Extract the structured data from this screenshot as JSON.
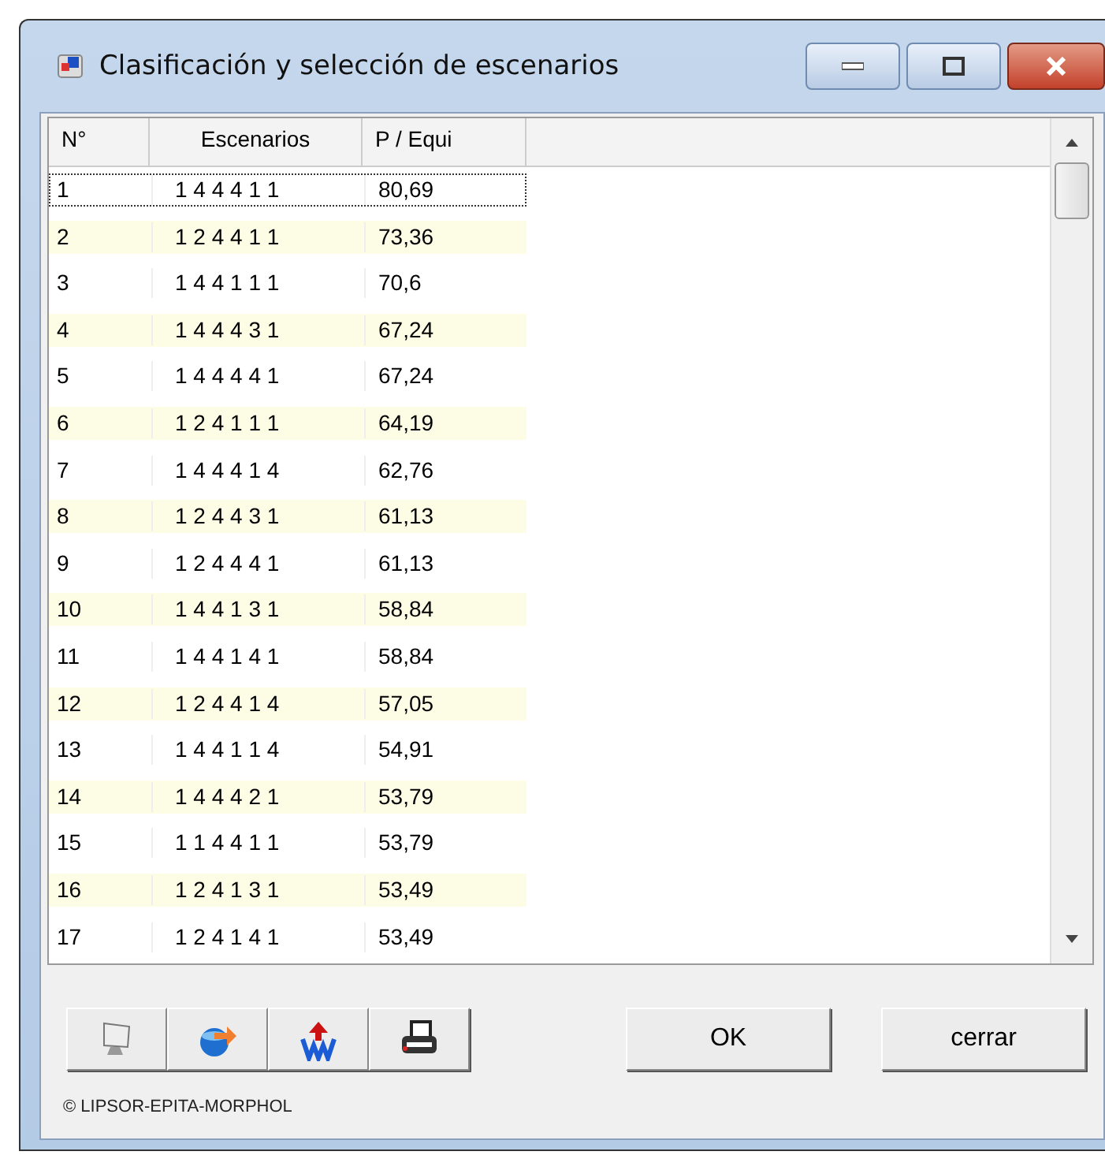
{
  "window": {
    "title": "Clasificación y selección de escenarios"
  },
  "table": {
    "columns": [
      "N°",
      "Escenarios",
      "P / Equi"
    ],
    "rows": [
      {
        "cells": [
          "1",
          "1 4 4 4 1 1",
          "80,69"
        ],
        "focused": true
      },
      {
        "cells": [
          "2",
          "1 2 4 4 1 1",
          "73,36"
        ],
        "focused": false
      },
      {
        "cells": [
          "3",
          "1 4 4 1 1 1",
          "70,6"
        ],
        "focused": false
      },
      {
        "cells": [
          "4",
          "1 4 4 4 3 1",
          "67,24"
        ],
        "focused": false
      },
      {
        "cells": [
          "5",
          "1 4 4 4 4 1",
          "67,24"
        ],
        "focused": false
      },
      {
        "cells": [
          "6",
          "1 2 4 1 1 1",
          "64,19"
        ],
        "focused": false
      },
      {
        "cells": [
          "7",
          "1 4 4 4 1 4",
          "62,76"
        ],
        "focused": false
      },
      {
        "cells": [
          "8",
          "1 2 4 4 3 1",
          "61,13"
        ],
        "focused": false
      },
      {
        "cells": [
          "9",
          "1 2 4 4 4 1",
          "61,13"
        ],
        "focused": false
      },
      {
        "cells": [
          "10",
          "1 4 4 1 3 1",
          "58,84"
        ],
        "focused": false
      },
      {
        "cells": [
          "11",
          "1 4 4 1 4 1",
          "58,84"
        ],
        "focused": false
      },
      {
        "cells": [
          "12",
          "1 2 4 4 1 4",
          "57,05"
        ],
        "focused": false
      },
      {
        "cells": [
          "13",
          "1 4 4 1 1 4",
          "54,91"
        ],
        "focused": false
      },
      {
        "cells": [
          "14",
          "1 4 4 4 2 1",
          "53,79"
        ],
        "focused": false
      },
      {
        "cells": [
          "15",
          "1 1 4 4 1 1",
          "53,79"
        ],
        "focused": false
      },
      {
        "cells": [
          "16",
          "1 2 4 1 3 1",
          "53,49"
        ],
        "focused": false
      },
      {
        "cells": [
          "17",
          "1 2 4 1 4 1",
          "53,49"
        ],
        "focused": false
      }
    ]
  },
  "toolbar": [
    {
      "kind": "monitor"
    },
    {
      "kind": "export"
    },
    {
      "kind": "word"
    },
    {
      "kind": "print"
    }
  ],
  "buttons": [
    "OK",
    "cerrar"
  ],
  "copyright": "© LIPSOR-EPITA-MORPHOL"
}
